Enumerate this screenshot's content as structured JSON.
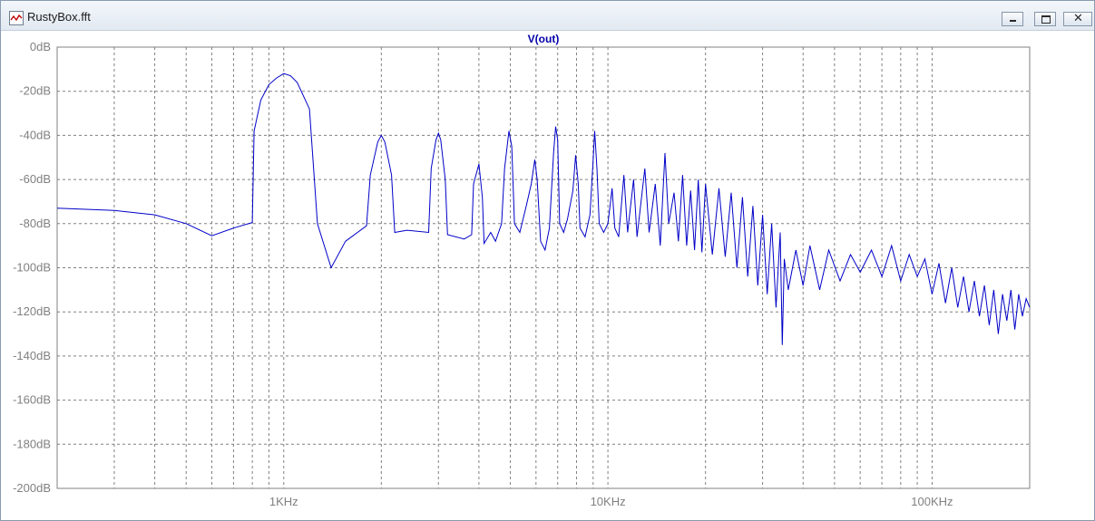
{
  "window": {
    "title": "RustyBox.fft",
    "icon": "waveform-icon",
    "controls": {
      "minimize": "minimize-icon",
      "maximize": "maximize-icon",
      "close": "✕"
    }
  },
  "chart_data": {
    "type": "line",
    "title": "V(out)",
    "xscale": "log",
    "xlim": [
      200,
      200000
    ],
    "ylim": [
      -200,
      0
    ],
    "xlabel": "",
    "ylabel": "",
    "grid": true,
    "x_ticks": [
      {
        "value": 1000,
        "label": "1KHz"
      },
      {
        "value": 10000,
        "label": "10KHz"
      },
      {
        "value": 100000,
        "label": "100KHz"
      }
    ],
    "y_ticks": [
      {
        "value": 0,
        "label": "0dB"
      },
      {
        "value": -20,
        "label": "-20dB"
      },
      {
        "value": -40,
        "label": "-40dB"
      },
      {
        "value": -60,
        "label": "-60dB"
      },
      {
        "value": -80,
        "label": "-80dB"
      },
      {
        "value": -100,
        "label": "-100dB"
      },
      {
        "value": -120,
        "label": "-120dB"
      },
      {
        "value": -140,
        "label": "-140dB"
      },
      {
        "value": -160,
        "label": "-160dB"
      },
      {
        "value": -180,
        "label": "-180dB"
      },
      {
        "value": -200,
        "label": "-200dB"
      }
    ],
    "colors": {
      "trace": "#0000c8",
      "grid": "#808080",
      "axis": "#808080",
      "title": "#0000a8"
    },
    "series": [
      {
        "name": "V(out)",
        "points": [
          [
            200,
            -73
          ],
          [
            300,
            -74
          ],
          [
            400,
            -76
          ],
          [
            500,
            -80
          ],
          [
            600,
            -85.5
          ],
          [
            700,
            -82
          ],
          [
            800,
            -79.5
          ],
          [
            810,
            -38
          ],
          [
            850,
            -24
          ],
          [
            900,
            -17
          ],
          [
            950,
            -14
          ],
          [
            1000,
            -12
          ],
          [
            1050,
            -13
          ],
          [
            1100,
            -16
          ],
          [
            1200,
            -28
          ],
          [
            1270,
            -80
          ],
          [
            1400,
            -100
          ],
          [
            1550,
            -88
          ],
          [
            1800,
            -81
          ],
          [
            1850,
            -58
          ],
          [
            1950,
            -43
          ],
          [
            2000,
            -40
          ],
          [
            2050,
            -43
          ],
          [
            2150,
            -58
          ],
          [
            2200,
            -84
          ],
          [
            2400,
            -83
          ],
          [
            2800,
            -84
          ],
          [
            2850,
            -55
          ],
          [
            2950,
            -42
          ],
          [
            3000,
            -39
          ],
          [
            3050,
            -42
          ],
          [
            3150,
            -60
          ],
          [
            3200,
            -85
          ],
          [
            3600,
            -87
          ],
          [
            3800,
            -85
          ],
          [
            3850,
            -62
          ],
          [
            4000,
            -53
          ],
          [
            4100,
            -68
          ],
          [
            4150,
            -89
          ],
          [
            4350,
            -84
          ],
          [
            4500,
            -88
          ],
          [
            4700,
            -80
          ],
          [
            4800,
            -55
          ],
          [
            4950,
            -38
          ],
          [
            5050,
            -45
          ],
          [
            5150,
            -80
          ],
          [
            5350,
            -84
          ],
          [
            5600,
            -72
          ],
          [
            5800,
            -62
          ],
          [
            5950,
            -51
          ],
          [
            6050,
            -60
          ],
          [
            6200,
            -88
          ],
          [
            6400,
            -92
          ],
          [
            6600,
            -82
          ],
          [
            6800,
            -48
          ],
          [
            6900,
            -36
          ],
          [
            7000,
            -42
          ],
          [
            7100,
            -80
          ],
          [
            7300,
            -84
          ],
          [
            7500,
            -78
          ],
          [
            7800,
            -65
          ],
          [
            7950,
            -49
          ],
          [
            8100,
            -62
          ],
          [
            8200,
            -82
          ],
          [
            8500,
            -86
          ],
          [
            8800,
            -76
          ],
          [
            9000,
            -52
          ],
          [
            9100,
            -38
          ],
          [
            9250,
            -55
          ],
          [
            9400,
            -80
          ],
          [
            9700,
            -84
          ],
          [
            10000,
            -80
          ],
          [
            10300,
            -64
          ],
          [
            10500,
            -82
          ],
          [
            10800,
            -86
          ],
          [
            11200,
            -58
          ],
          [
            11500,
            -84
          ],
          [
            12000,
            -60
          ],
          [
            12300,
            -86
          ],
          [
            13000,
            -55
          ],
          [
            13400,
            -84
          ],
          [
            14000,
            -62
          ],
          [
            14500,
            -90
          ],
          [
            15000,
            -48
          ],
          [
            15400,
            -80
          ],
          [
            16000,
            -66
          ],
          [
            16500,
            -88
          ],
          [
            17000,
            -58
          ],
          [
            17500,
            -90
          ],
          [
            18000,
            -65
          ],
          [
            18500,
            -92
          ],
          [
            19000,
            -60
          ],
          [
            19500,
            -93
          ],
          [
            20000,
            -62
          ],
          [
            21000,
            -94
          ],
          [
            22000,
            -64
          ],
          [
            23000,
            -95
          ],
          [
            24000,
            -66
          ],
          [
            25000,
            -100
          ],
          [
            26000,
            -68
          ],
          [
            27000,
            -104
          ],
          [
            28000,
            -72
          ],
          [
            29000,
            -108
          ],
          [
            30000,
            -76
          ],
          [
            31000,
            -112
          ],
          [
            32000,
            -80
          ],
          [
            33000,
            -118
          ],
          [
            34000,
            -84
          ],
          [
            34500,
            -135
          ],
          [
            35000,
            -96
          ],
          [
            36000,
            -110
          ],
          [
            38000,
            -92
          ],
          [
            40000,
            -108
          ],
          [
            42000,
            -90
          ],
          [
            45000,
            -110
          ],
          [
            48000,
            -92
          ],
          [
            52000,
            -106
          ],
          [
            56000,
            -94
          ],
          [
            60000,
            -102
          ],
          [
            65000,
            -92
          ],
          [
            70000,
            -104
          ],
          [
            75000,
            -90
          ],
          [
            80000,
            -106
          ],
          [
            85000,
            -94
          ],
          [
            90000,
            -104
          ],
          [
            95000,
            -96
          ],
          [
            100000,
            -112
          ],
          [
            105000,
            -98
          ],
          [
            110000,
            -116
          ],
          [
            115000,
            -100
          ],
          [
            120000,
            -118
          ],
          [
            125000,
            -104
          ],
          [
            130000,
            -120
          ],
          [
            135000,
            -106
          ],
          [
            140000,
            -122
          ],
          [
            145000,
            -108
          ],
          [
            150000,
            -126
          ],
          [
            155000,
            -110
          ],
          [
            160000,
            -130
          ],
          [
            165000,
            -112
          ],
          [
            170000,
            -124
          ],
          [
            175000,
            -110
          ],
          [
            180000,
            -128
          ],
          [
            185000,
            -112
          ],
          [
            190000,
            -122
          ],
          [
            195000,
            -114
          ],
          [
            200000,
            -118
          ]
        ]
      }
    ]
  }
}
